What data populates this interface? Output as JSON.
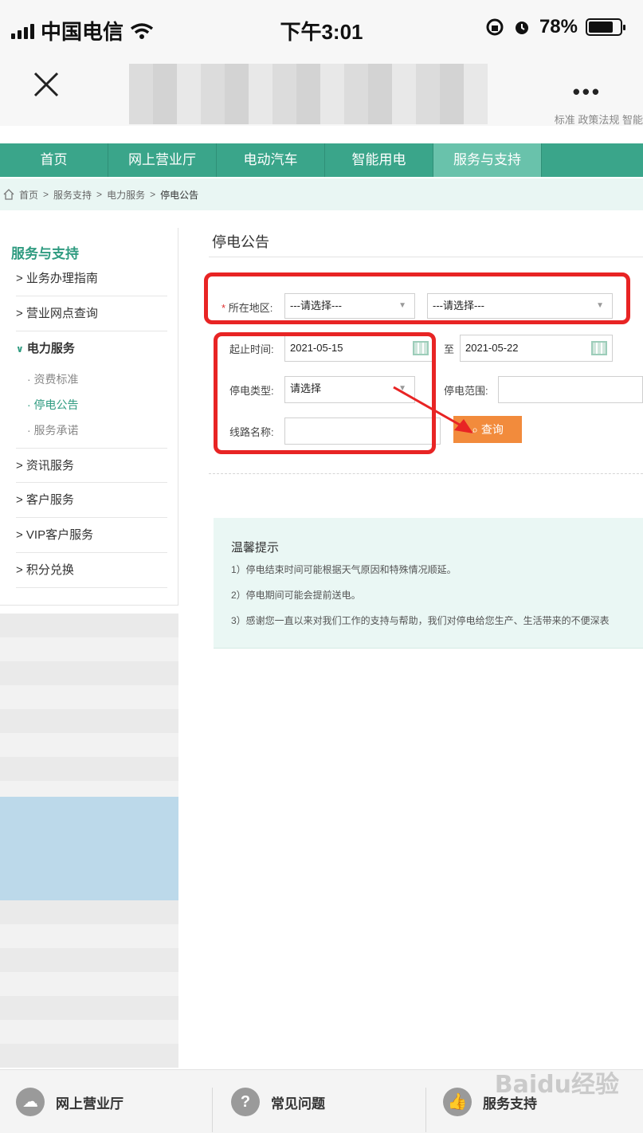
{
  "status_bar": {
    "carrier": "中国电信",
    "time": "下午3:01",
    "battery": "78%",
    "battery_level": 0.78
  },
  "top_links": "标准  政策法规  智能",
  "nav": {
    "items": [
      "首页",
      "网上营业厅",
      "电动汽车",
      "智能用电",
      "服务与支持"
    ],
    "active": "服务与支持"
  },
  "breadcrumb": [
    "首页",
    "服务支持",
    "电力服务",
    "停电公告"
  ],
  "sidebar": {
    "title": "服务与支持",
    "items": [
      "> 业务办理指南",
      "> 营业网点查询",
      "电力服务",
      "> 资讯服务",
      "> 客户服务",
      "> VIP客户服务",
      "> 积分兑换"
    ],
    "sub_items": [
      "· 资费标准",
      "· 停电公告",
      "· 服务承诺"
    ]
  },
  "main": {
    "title": "停电公告",
    "form": {
      "region_label": "所在地区:",
      "region_select_1": "---请选择---",
      "region_select_2": "---请选择---",
      "start_label": "起止时间:",
      "start_date": "2021-05-15",
      "to_label": "至",
      "end_date": "2021-05-22",
      "type_label": "停电类型:",
      "type_value": "请选择",
      "range_label": "停电范围:",
      "line_label": "线路名称:",
      "query_button": "查询"
    },
    "tips": {
      "title": "温馨提示",
      "items": [
        "1）停电结束时间可能根据天气原因和特殊情况顺延。",
        "2）停电期间可能会提前送电。",
        "3）感谢您一直以来对我们工作的支持与帮助，我们对停电给您生产、生活带来的不便深表"
      ]
    }
  },
  "bottom_bar": {
    "items": [
      {
        "label": "网上营业厅",
        "icon": "cloud-icon"
      },
      {
        "label": "常见问题",
        "icon": "question-icon"
      },
      {
        "label": "服务支持",
        "icon": "thumbs-up-icon"
      }
    ]
  },
  "watermark": "Baidu经验",
  "colors": {
    "brand_green": "#3aa58a",
    "active_nav": "#69c2ab",
    "query_orange": "#f28b3c",
    "annotation_red": "#e82424"
  }
}
